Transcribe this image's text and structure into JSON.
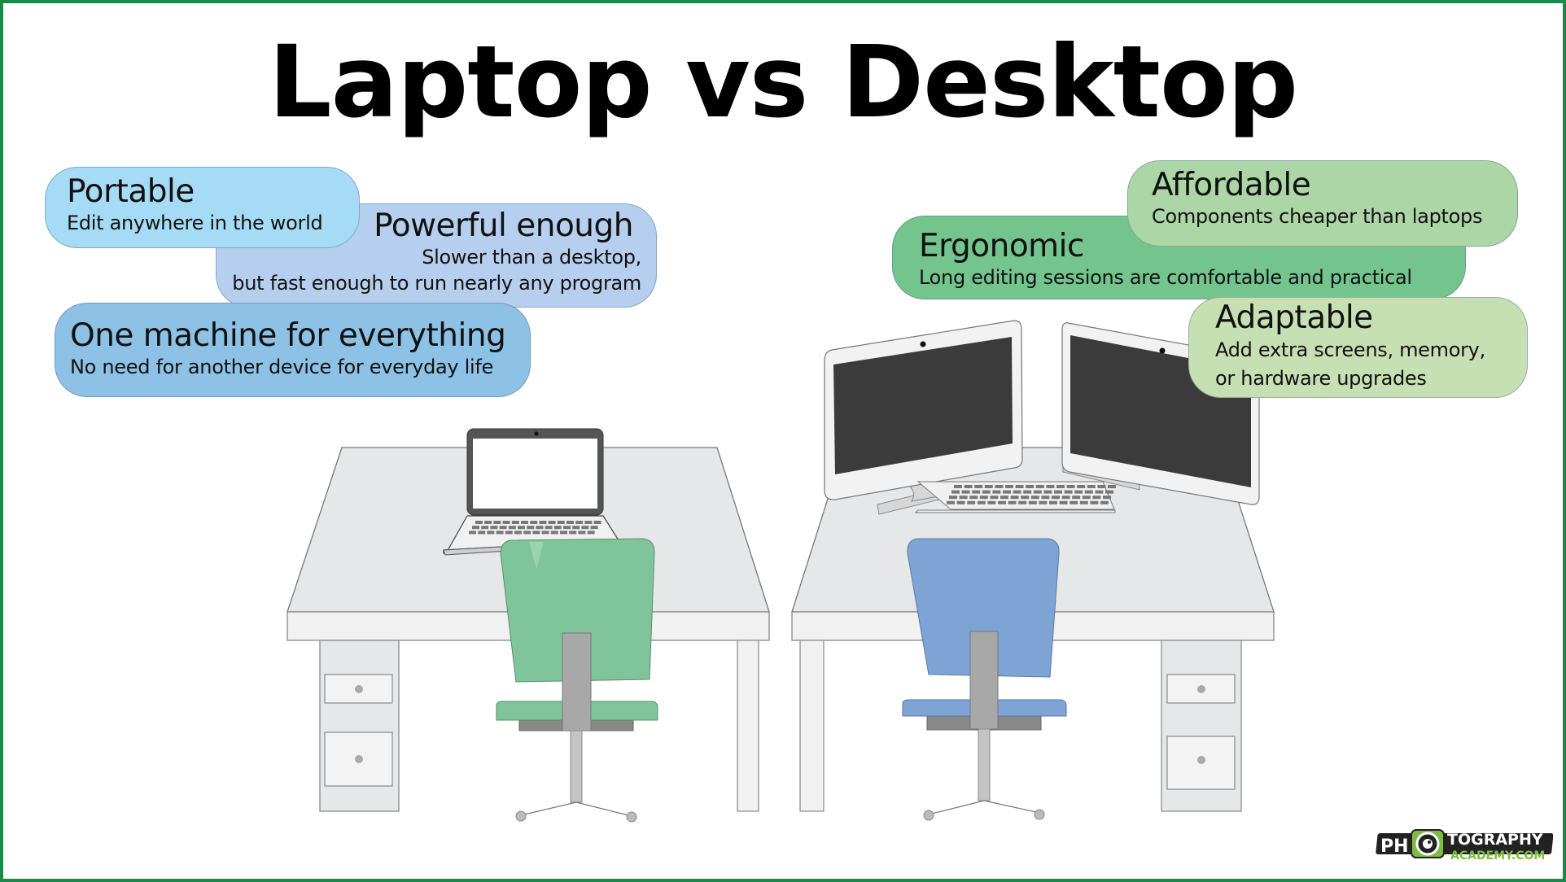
{
  "title": "Laptop vs Desktop",
  "laptop_benefits": [
    {
      "heading": "Portable",
      "lines": [
        "Edit anywhere in the world"
      ]
    },
    {
      "heading": "Powerful enough",
      "lines": [
        "Slower than a desktop,",
        "but fast enough to run nearly any program"
      ]
    },
    {
      "heading": "One machine for everything",
      "lines": [
        "No need for another device for everyday life"
      ]
    }
  ],
  "desktop_benefits": [
    {
      "heading": "Affordable",
      "lines": [
        "Components cheaper than laptops"
      ]
    },
    {
      "heading": "Ergonomic",
      "lines": [
        "Long editing sessions are comfortable and practical"
      ]
    },
    {
      "heading": "Adaptable",
      "lines": [
        "Add extra screens, memory,",
        "or hardware upgrades"
      ]
    }
  ],
  "logo": {
    "line1": "PH",
    "line1b": "TOGRAPHY",
    "line2": "ACADEMY.COM"
  },
  "colors": {
    "border": "#1a8a4a",
    "laptop_chair": "#7fc49b",
    "desktop_chair": "#7ea4d6",
    "desk": "#e6e7e8",
    "screen_dark": "#3b3b3b"
  }
}
